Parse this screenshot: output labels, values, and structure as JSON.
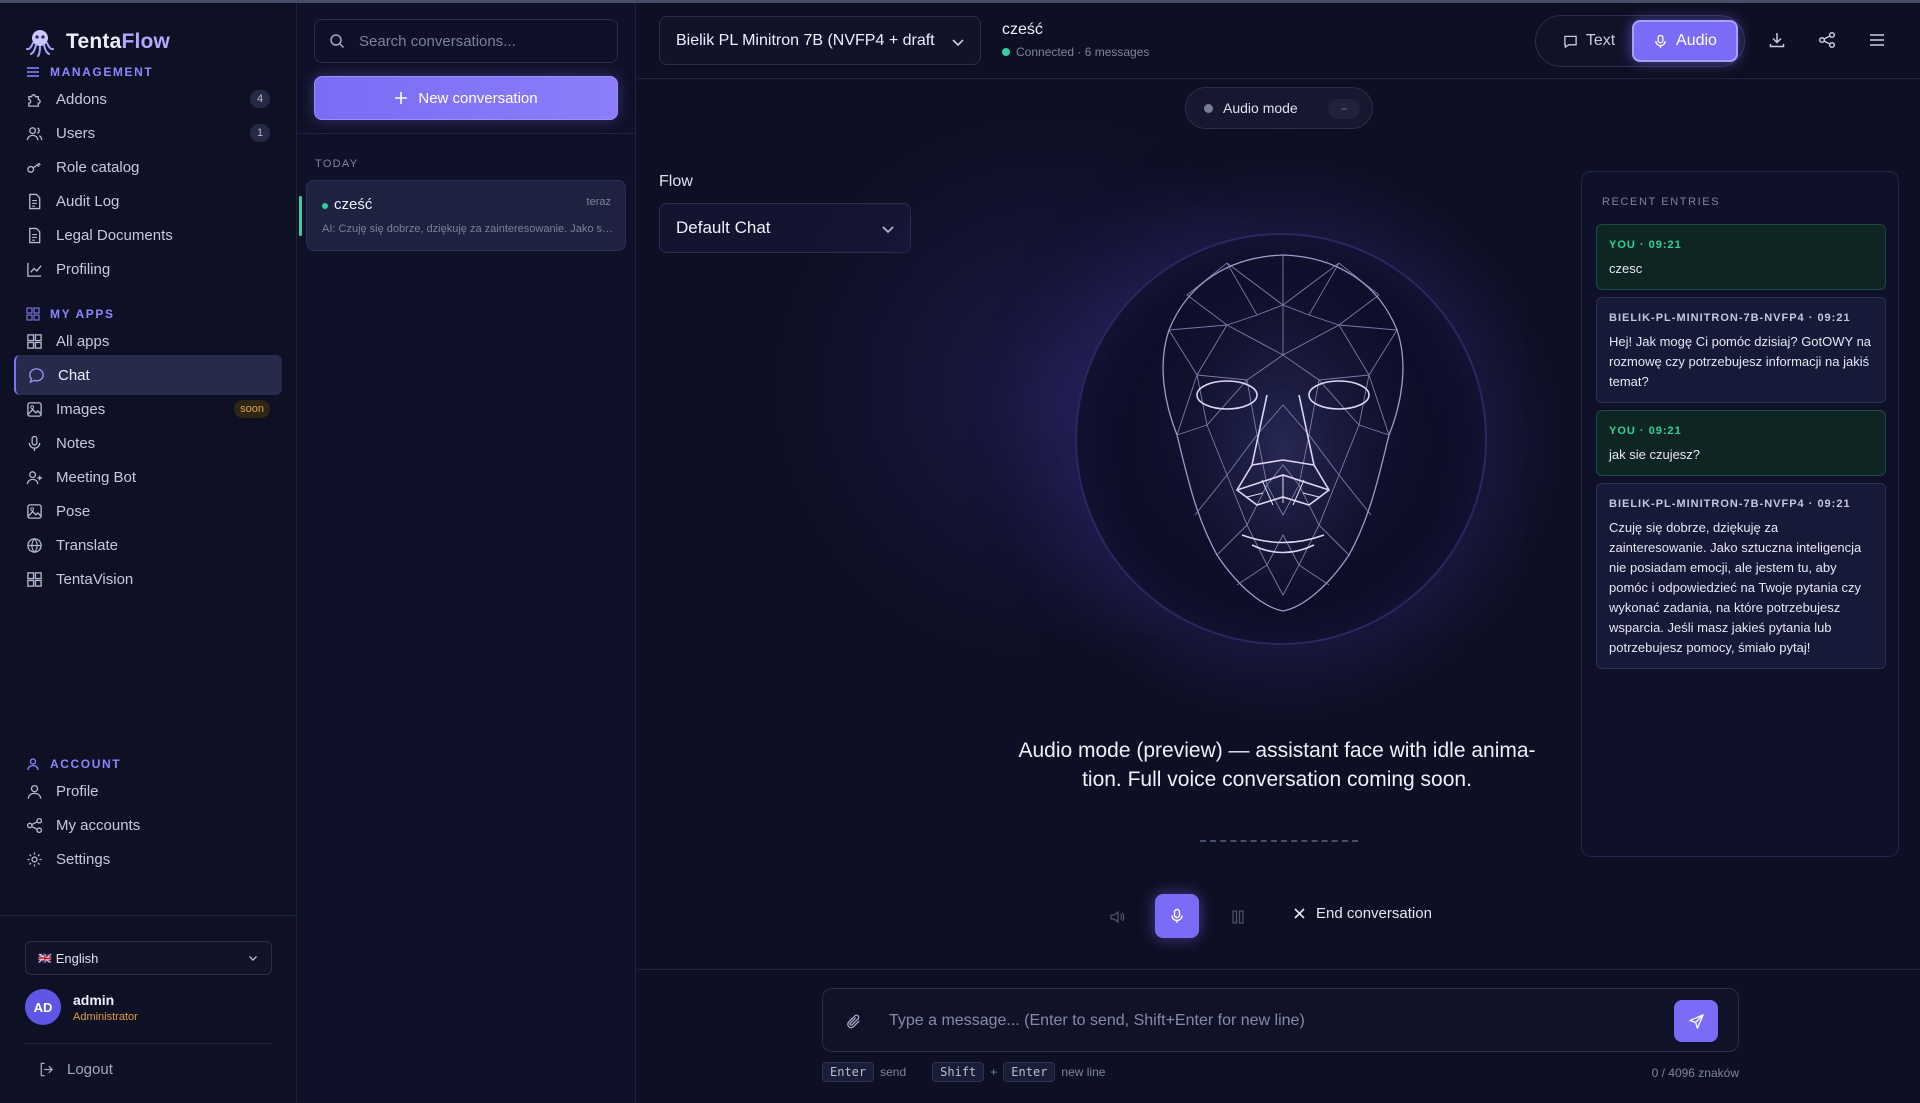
{
  "app": {
    "brand_prefix": "Tenta",
    "brand_suffix": "Flow"
  },
  "sidebar": {
    "management_title": "MANAGEMENT",
    "management_items": [
      {
        "label": "Addons",
        "badge": "4",
        "icon": "puzzle-icon"
      },
      {
        "label": "Users",
        "badge": "1",
        "icon": "users-icon"
      },
      {
        "label": "Role catalog",
        "icon": "key-icon"
      },
      {
        "label": "Audit Log",
        "icon": "document-icon"
      },
      {
        "label": "Legal Documents",
        "icon": "document-icon"
      },
      {
        "label": "Profiling",
        "icon": "chart-line-icon"
      }
    ],
    "apps_title": "MY APPS",
    "apps_items": [
      {
        "label": "All apps",
        "icon": "grid-icon"
      },
      {
        "label": "Chat",
        "icon": "chat-bubble-icon",
        "active": true
      },
      {
        "label": "Images",
        "badge": "soon",
        "icon": "image-icon"
      },
      {
        "label": "Notes",
        "icon": "microphone-icon"
      },
      {
        "label": "Meeting Bot",
        "icon": "user-plus-icon"
      },
      {
        "label": "Pose",
        "icon": "image-icon"
      },
      {
        "label": "Translate",
        "icon": "globe-icon"
      },
      {
        "label": "TentaVision",
        "icon": "grid-icon"
      }
    ],
    "account_title": "ACCOUNT",
    "account_items": [
      {
        "label": "Profile",
        "icon": "user-icon"
      },
      {
        "label": "My accounts",
        "icon": "share-icon"
      },
      {
        "label": "Settings",
        "icon": "gear-icon"
      }
    ],
    "language": "English",
    "language_flag": "🇬🇧",
    "user": {
      "initials": "AD",
      "name": "admin",
      "role": "Administrator"
    },
    "logout_label": "Logout"
  },
  "conversations": {
    "search_placeholder": "Search conversations...",
    "new_label": "New conversation",
    "group_label": "TODAY",
    "items": [
      {
        "title": "cześć",
        "time": "teraz",
        "snippet": "AI: Czuję się dobrze, dziękuję za zainteresowanie. Jako sztuczna inteligencja..."
      }
    ]
  },
  "topbar": {
    "model": "Bielik PL Minitron 7B (NVFP4 + draft",
    "chat_title": "cześć",
    "status": "Connected · 6 messages",
    "mode_text": "Text",
    "mode_audio": "Audio",
    "active_mode": "Audio"
  },
  "audio": {
    "chip_label": "Audio mode",
    "chip_value": "–",
    "flow_label": "Flow",
    "flow_value": "Default Chat",
    "caption_line1": "Audio mode (preview) — assistant face with idle anima-",
    "caption_line2": "tion. Full voice conversation coming soon.",
    "end_label": "End conversation"
  },
  "recent": {
    "title": "RECENT ENTRIES",
    "entries": [
      {
        "role": "you",
        "who": "YOU · 09:21",
        "text": "czesc"
      },
      {
        "role": "bot",
        "who": "BIELIK-PL-MINITRON-7B-NVFP4 · 09:21",
        "text": "Hej! Jak mogę Ci pomóc dzisiaj? GotOWY na rozmowę czy potrzebujesz informacji na jakiś temat?"
      },
      {
        "role": "you",
        "who": "YOU · 09:21",
        "text": "jak sie czujesz?"
      },
      {
        "role": "bot",
        "who": "BIELIK-PL-MINITRON-7B-NVFP4 · 09:21",
        "text": "Czuję się dobrze, dziękuję za zainteresowanie. Jako sztuczna inteligencja nie posiadam emocji, ale jestem tu, aby pomóc i odpowiedzieć na Twoje pytania czy wykonać zadania, na które potrzebujesz wsparcia. Jeśli masz jakieś pytania lub potrzebujesz pomocy, śmiało pytaj!"
      }
    ]
  },
  "composer": {
    "placeholder": "Type a message... (Enter to send, Shift+Enter for new line)",
    "hint_enter_key": "Enter",
    "hint_enter_text": "send",
    "hint_shift_key": "Shift",
    "hint_plus": "+",
    "hint_enter2_key": "Enter",
    "hint_newline_text": "new line",
    "counter": "0 / 4096 znaków"
  },
  "colors": {
    "accent": "#7a6cf6",
    "online": "#2fd1a0",
    "background": "#0d0f22",
    "soon_badge": "#e2a244"
  }
}
